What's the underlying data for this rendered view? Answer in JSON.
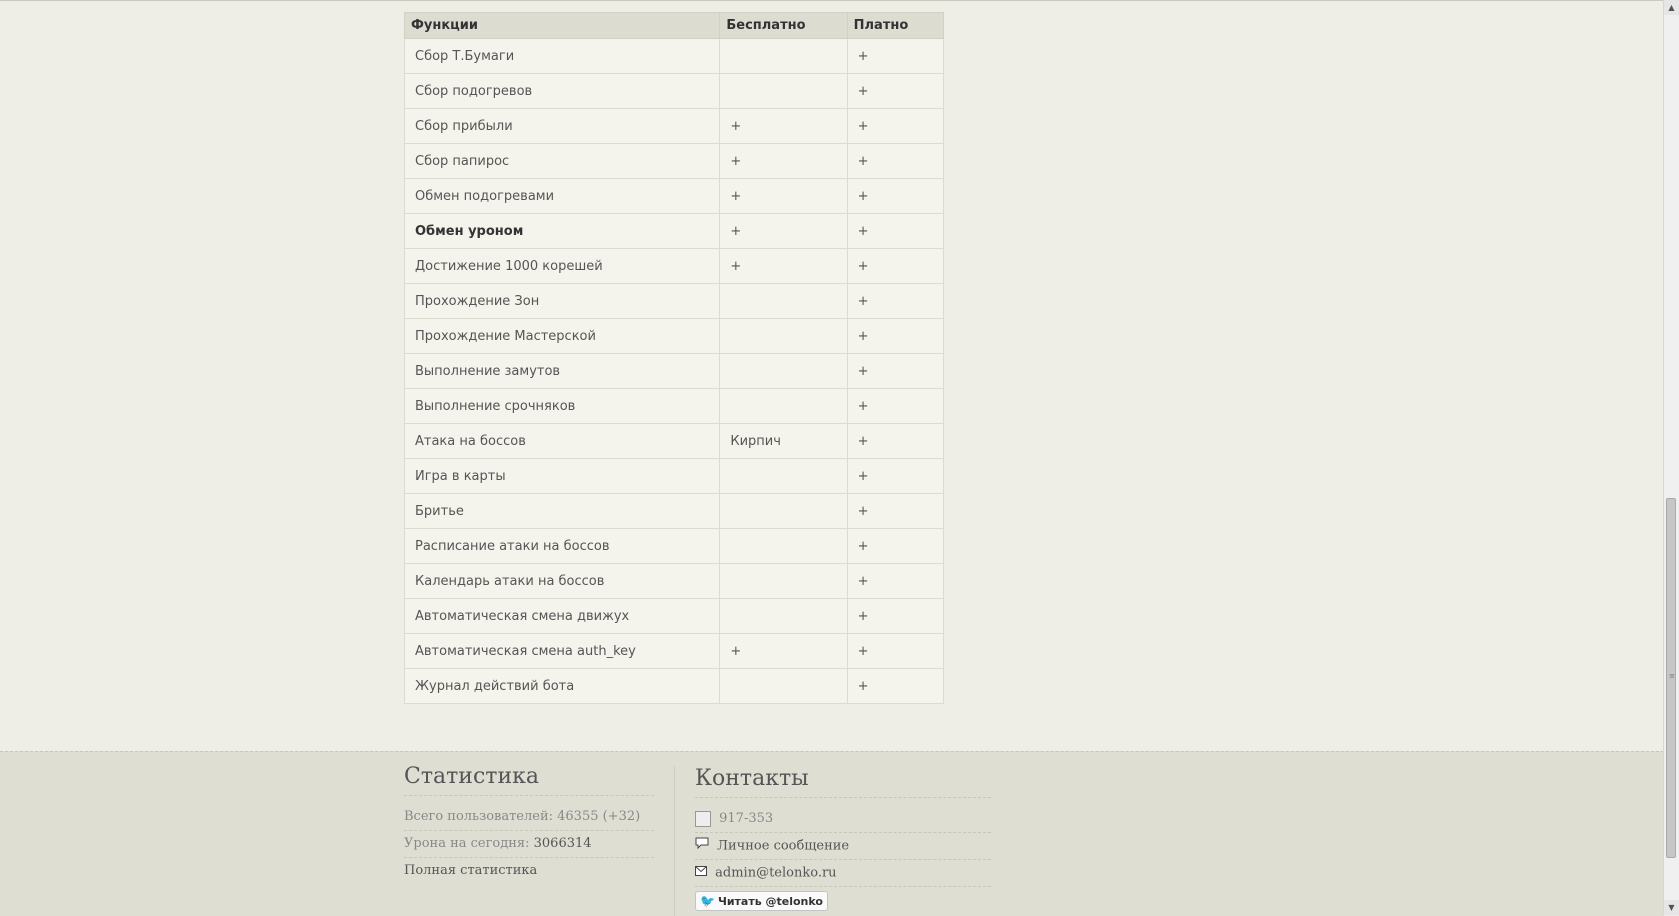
{
  "table": {
    "headers": [
      "Функции",
      "Бесплатно",
      "Платно"
    ],
    "rows": [
      {
        "name": "Сбор Т.Бумаги",
        "free": "",
        "paid": "+"
      },
      {
        "name": "Сбор подогревов",
        "free": "",
        "paid": "+"
      },
      {
        "name": "Сбор прибыли",
        "free": "+",
        "paid": "+"
      },
      {
        "name": "Сбор папирос",
        "free": "+",
        "paid": "+"
      },
      {
        "name": "Обмен подогревами",
        "free": "+",
        "paid": "+"
      },
      {
        "name": "Обмен уроном",
        "free": "+",
        "paid": "+",
        "bold": true
      },
      {
        "name": "Достижение 1000 корешей",
        "free": "+",
        "paid": "+"
      },
      {
        "name": "Прохождение Зон",
        "free": "",
        "paid": "+"
      },
      {
        "name": "Прохождение Мастерской",
        "free": "",
        "paid": "+"
      },
      {
        "name": "Выполнение замутов",
        "free": "",
        "paid": "+"
      },
      {
        "name": "Выполнение срочняков",
        "free": "",
        "paid": "+"
      },
      {
        "name": "Атака на боссов",
        "free": "Кирпич",
        "paid": "+"
      },
      {
        "name": "Игра в карты",
        "free": "",
        "paid": "+"
      },
      {
        "name": "Бритье",
        "free": "",
        "paid": "+"
      },
      {
        "name": "Расписание атаки на боссов",
        "free": "",
        "paid": "+"
      },
      {
        "name": "Календарь атаки на боссов",
        "free": "",
        "paid": "+"
      },
      {
        "name": "Автоматическая смена движух",
        "free": "",
        "paid": "+"
      },
      {
        "name": "Автоматическая смена auth_key",
        "free": "+",
        "paid": "+"
      },
      {
        "name": "Журнал действий бота",
        "free": "",
        "paid": "+"
      }
    ]
  },
  "footer": {
    "stats": {
      "title": "Статистика",
      "users_label": "Всего пользователей: 46355 (+32)",
      "damage_label": "Урона на сегодня:",
      "damage_value": "3066314",
      "full_stats_link": "Полная статистика"
    },
    "contacts": {
      "title": "Контакты",
      "icq": "917-353",
      "pm_link": "Личное сообщение",
      "email": "admin@telonko.ru",
      "twitter_button": "Читать @telonko"
    }
  },
  "icons": {
    "pm": "speech-bubble-icon",
    "email": "envelope-icon",
    "twitter": "twitter-bird-icon"
  }
}
